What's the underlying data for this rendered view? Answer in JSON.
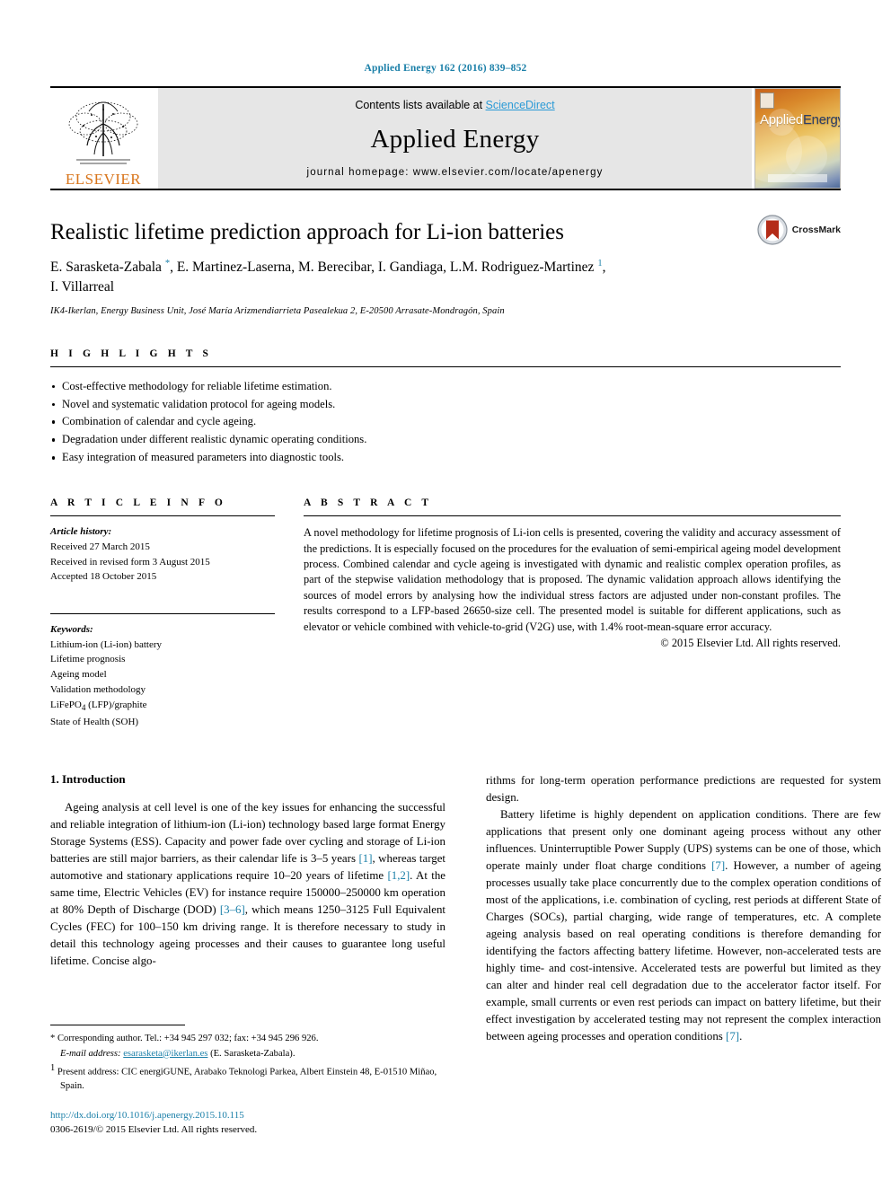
{
  "running_head": "Applied Energy 162 (2016) 839–852",
  "banner": {
    "publisher_name": "ELSEVIER",
    "contents_prefix": "Contents lists available at ",
    "contents_link": "ScienceDirect",
    "journal_title": "Applied Energy",
    "homepage": "journal homepage: www.elsevier.com/locate/apenergy",
    "cover_title_part1": "Applied",
    "cover_title_part2": "Energy"
  },
  "article": {
    "title": "Realistic lifetime prediction approach for Li-ion batteries",
    "crossmark_label": "CrossMark",
    "authors_line1": "E. Sarasketa-Zabala ",
    "authors_star": "*",
    "authors_line1b": ", E. Martinez-Laserna, M. Berecibar, I. Gandiaga, L.M. Rodriguez-Martinez ",
    "authors_sup1": "1",
    "authors_line1c": ",",
    "authors_line2": "I. Villarreal",
    "affiliation": "IK4-Ikerlan, Energy Business Unit, José María Arizmendiarrieta Pasealekua 2, E-20500 Arrasate-Mondragón, Spain"
  },
  "highlights": {
    "heading": "H I G H L I G H T S",
    "items": [
      "Cost-effective methodology for reliable lifetime estimation.",
      "Novel and systematic validation protocol for ageing models.",
      "Combination of calendar and cycle ageing.",
      "Degradation under different realistic dynamic operating conditions.",
      "Easy integration of measured parameters into diagnostic tools."
    ]
  },
  "article_info": {
    "heading": "A R T I C L E   I N F O",
    "history_label": "Article history:",
    "history": [
      "Received 27 March 2015",
      "Received in revised form 3 August 2015",
      "Accepted 18 October 2015"
    ],
    "keywords_label": "Keywords:",
    "keywords": [
      "Lithium-ion (Li-ion) battery",
      "Lifetime prognosis",
      "Ageing model",
      "Validation methodology",
      "LiFePO4 (LFP)/graphite",
      "State of Health (SOH)"
    ]
  },
  "abstract": {
    "heading": "A B S T R A C T",
    "text": "A novel methodology for lifetime prognosis of Li-ion cells is presented, covering the validity and accuracy assessment of the predictions. It is especially focused on the procedures for the evaluation of semi-empirical ageing model development process. Combined calendar and cycle ageing is investigated with dynamic and realistic complex operation profiles, as part of the stepwise validation methodology that is proposed. The dynamic validation approach allows identifying the sources of model errors by analysing how the individual stress factors are adjusted under non-constant profiles. The results correspond to a LFP-based 26650-size cell. The presented model is suitable for different applications, such as elevator or vehicle combined with vehicle-to-grid (V2G) use, with 1.4% root-mean-square error accuracy.",
    "copyright": "© 2015 Elsevier Ltd. All rights reserved."
  },
  "introduction": {
    "heading": "1. Introduction",
    "left_para1_a": "Ageing analysis at cell level is one of the key issues for enhancing the successful and reliable integration of lithium-ion (Li-ion) technology based large format Energy Storage Systems (ESS). Capacity and power fade over cycling and storage of Li-ion batteries are still major barriers, as their calendar life is 3–5 years ",
    "ref1": "[1]",
    "left_para1_b": ", whereas target automotive and stationary applications require 10–20 years of lifetime ",
    "ref12": "[1,2]",
    "left_para1_c": ". At the same time, Electric Vehicles (EV) for instance require 150000–250000 km operation at 80% Depth of Discharge (DOD) ",
    "ref36": "[3–6]",
    "left_para1_d": ", which means 1250–3125 Full Equivalent Cycles (FEC) for 100–150 km driving range. It is therefore necessary to study in detail this technology ageing processes and their causes to guarantee long useful lifetime. Concise algo-",
    "right_para1": "rithms for long-term operation performance predictions are requested for system design.",
    "right_para2_a": "Battery lifetime is highly dependent on application conditions. There are few applications that present only one dominant ageing process without any other influences. Uninterruptible Power Supply (UPS) systems can be one of those, which operate mainly under float charge conditions ",
    "ref7a": "[7]",
    "right_para2_b": ". However, a number of ageing processes usually take place concurrently due to the complex operation conditions of most of the applications, i.e. combination of cycling, rest periods at different State of Charges (SOCs), partial charging, wide range of temperatures, etc. A complete ageing analysis based on real operating conditions is therefore demanding for identifying the factors affecting battery lifetime. However, non-accelerated tests are highly time- and cost-intensive. Accelerated tests are powerful but limited as they can alter and hinder real cell degradation due to the accelerator factor itself. For example, small currents or even rest periods can impact on battery lifetime, but their effect investigation by accelerated testing may not represent the complex interaction between ageing processes and operation conditions ",
    "ref7b": "[7]",
    "right_para2_c": "."
  },
  "footnotes": {
    "corresponding_mark": "*",
    "corresponding_text": "Corresponding author. Tel.: +34 945 297 032; fax: +34 945 296 926.",
    "email_label": "E-mail address:",
    "email": "esarasketa@ikerlan.es",
    "email_suffix": "(E. Sarasketa-Zabala).",
    "present_mark": "1",
    "present_text": "Present address: CIC energiGUNE, Arabako Teknologi Parkea, Albert Einstein 48, E-01510 Miñao, Spain.",
    "doi": "http://dx.doi.org/10.1016/j.apenergy.2015.10.115",
    "issn_line_a": "0306-2619/",
    "issn_line_b": "© 2015 Elsevier Ltd. All rights reserved."
  },
  "colors": {
    "link": "#1a7fa8",
    "sciencedirect": "#2a9ad6",
    "elsevier_orange": "#d8741a",
    "banner_gray": "#e6e6e6"
  }
}
